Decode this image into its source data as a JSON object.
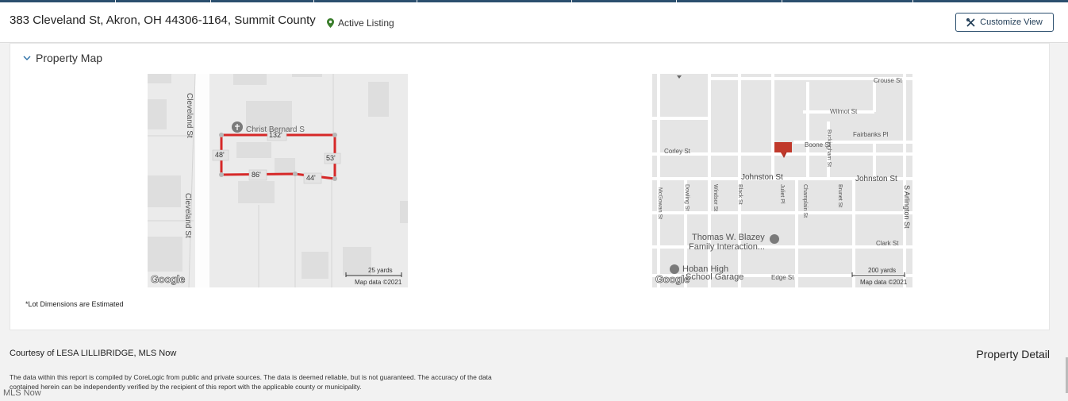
{
  "header": {
    "address": "383 Cleveland St, Akron, OH 44306-1164, Summit County",
    "status": "Active Listing",
    "customize_label": "Customize View"
  },
  "section": {
    "title": "Property Map"
  },
  "lot_map": {
    "street_label_top": "Cleveland St",
    "street_label_bottom": "Cleveland St",
    "poi_label": "Christ Bernard S",
    "dims": {
      "top": "132'",
      "left": "48'",
      "right": "53'",
      "bottom_left": "86'",
      "bottom_right": "44'"
    },
    "scale": "25 yards",
    "map_data": "Map data ©2021",
    "logo": "Google"
  },
  "area_map": {
    "streets": {
      "crouse": "Crouse St",
      "wilmot": "Wilmot St",
      "fairbanks": "Fairbanks Pl",
      "boone": "Boone St",
      "corley": "Corley St",
      "buckingham": "Buckingham St",
      "johnston_left": "Johnston St",
      "johnston_right": "Johnston St",
      "mcgowan": "McGowan St",
      "dowling": "Dowling St",
      "windsor": "Windsor St",
      "black": "Black St",
      "juliet": "Juliet Pl",
      "champlain": "Champlain St",
      "brunet": "Brunet St",
      "arlington": "S Arlington St",
      "clark": "Clark St",
      "edge": "Edge St"
    },
    "poi1_line1": "Thomas W. Blazey",
    "poi1_line2": "Family Interaction...",
    "poi2_line1": "Hoban High",
    "poi2_line2": "School Garage",
    "scale": "200 yards",
    "map_data": "Map data ©2021",
    "logo": "Google"
  },
  "lot_note": "*Lot Dimensions are Estimated",
  "footer": {
    "courtesy": "Courtesy of LESA LILLIBRIDGE, MLS Now",
    "property_detail": "Property Detail",
    "disclaimer": "The data within this report is compiled by CoreLogic from public and private sources. The data is deemed reliable, but is not guaranteed. The accuracy of the data contained herein can be independently verified by the recipient of this report with the applicable county or municipality.",
    "watermark": "MLS Now"
  },
  "colors": {
    "accent": "#2b4f6e",
    "lot_line": "#d62828",
    "marker": "#c0392b",
    "status_pin": "#3a7d2c"
  }
}
